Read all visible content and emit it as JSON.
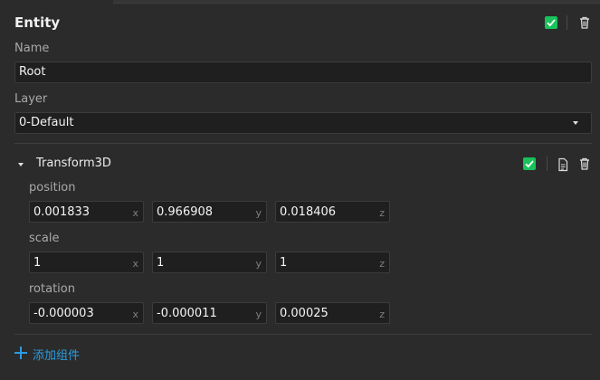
{
  "entity": {
    "title": "Entity",
    "enabled": true,
    "name_label": "Name",
    "name_value": "Root",
    "layer_label": "Layer",
    "layer_value": "0-Default"
  },
  "transform": {
    "title": "Transform3D",
    "enabled": true,
    "position": {
      "label": "position",
      "x": "0.001833",
      "y": "0.966908",
      "z": "0.018406"
    },
    "scale": {
      "label": "scale",
      "x": "1",
      "y": "1",
      "z": "1"
    },
    "rotation": {
      "label": "rotation",
      "x": "-0.000003",
      "y": "-0.000011",
      "z": "0.00025"
    },
    "axis_x": "x",
    "axis_y": "y",
    "axis_z": "z"
  },
  "add_component_label": "添加组件",
  "icons": {
    "check": "check-icon",
    "trash": "trash-icon",
    "document": "document-icon",
    "plus": "plus-icon",
    "caret": "caret-down-icon"
  },
  "colors": {
    "accent": "#2a9de0",
    "checkbox": "#19c25a"
  }
}
